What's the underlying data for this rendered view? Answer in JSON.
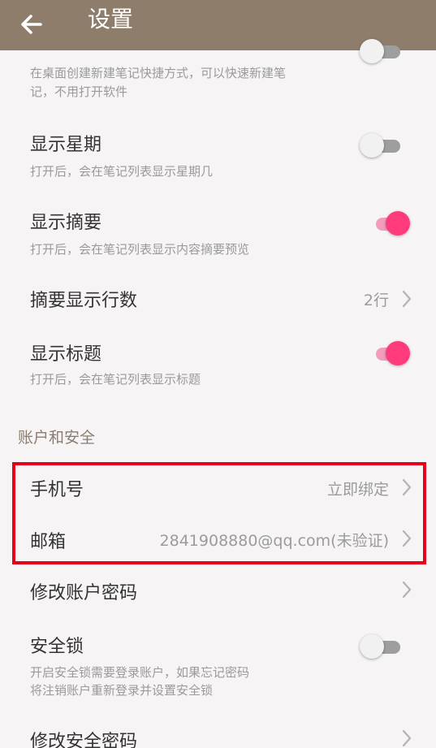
{
  "header": {
    "title": "设置"
  },
  "shortcut": {
    "desc_line1": "在桌面创建新建笔记快捷方式，可以快速新建笔",
    "desc_line2": "记，不用打开软件"
  },
  "show_week": {
    "label": "显示星期",
    "desc": "打开后，会在笔记列表显示星期几",
    "enabled": false
  },
  "show_summary": {
    "label": "显示摘要",
    "desc": "打开后，会在笔记列表显示内容摘要预览",
    "enabled": true
  },
  "summary_lines": {
    "label": "摘要显示行数",
    "value": "2行"
  },
  "show_title": {
    "label": "显示标题",
    "desc": "打开后，会在笔记列表显示标题",
    "enabled": true
  },
  "account_section": {
    "title": "账户和安全"
  },
  "phone": {
    "label": "手机号",
    "value": "立即绑定"
  },
  "email": {
    "label": "邮箱",
    "value": "2841908880@qq.com(未验证)"
  },
  "change_account_password": {
    "label": "修改账户密码"
  },
  "security_lock": {
    "label": "安全锁",
    "desc_line1": "开启安全锁需要登录账户，如果忘记密码",
    "desc_line2": "将注销账户重新登录并设置安全锁",
    "enabled": false
  },
  "change_security_password": {
    "label": "修改安全密码"
  },
  "colors": {
    "header_bg": "#8e7d6b",
    "accent": "#ff3b7b",
    "highlight_border": "#e3001b"
  }
}
